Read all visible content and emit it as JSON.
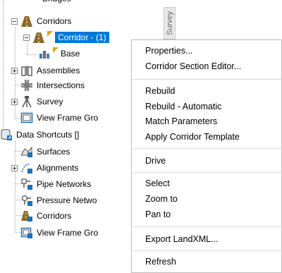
{
  "tree": {
    "corridors": "Corridors",
    "corridor_1": "Corridor - (1)",
    "baseline": "Base",
    "assemblies": "Assemblies",
    "intersections": "Intersections",
    "survey": "Survey",
    "view_frame_groups": "View Frame Gro",
    "data_shortcuts": "Data Shortcuts []",
    "ds_surfaces": "Surfaces",
    "ds_alignments": "Alignments",
    "ds_pipe_networks": "Pipe Networks",
    "ds_pressure_networks": "Pressure Netwo",
    "ds_corridors": "Corridors",
    "ds_view_frame_groups": "View Frame Gro"
  },
  "side_tab": {
    "label": "Survey"
  },
  "context_menu": {
    "properties": "Properties...",
    "corridor_section_editor": "Corridor Section Editor...",
    "rebuild": "Rebuild",
    "rebuild_automatic": "Rebuild - Automatic",
    "match_parameters": "Match Parameters",
    "apply_corridor_template": "Apply Corridor Template",
    "drive": "Drive",
    "select": "Select",
    "zoom_to": "Zoom to",
    "pan_to": "Pan to",
    "export_landxml": "Export LandXML...",
    "refresh": "Refresh"
  },
  "colors": {
    "selection": "#0078d7",
    "road_icon": "#8a6a30",
    "shortcut_blue": "#1f6fb5",
    "warning_orange": "#e8a317"
  },
  "icons": {
    "corridor": "corridor-road-icon",
    "baseline": "baseline-icon",
    "assemblies": "assembly-icon",
    "intersections": "intersection-icon",
    "survey": "survey-icon",
    "view_frame_groups": "view-frame-icon",
    "data_shortcuts": "data-shortcuts-icon",
    "surfaces": "surface-icon",
    "alignments": "alignment-icon",
    "pipe_networks": "pipe-network-icon",
    "pressure_networks": "pressure-network-icon",
    "ds_corridors": "corridor-shortcut-icon"
  }
}
